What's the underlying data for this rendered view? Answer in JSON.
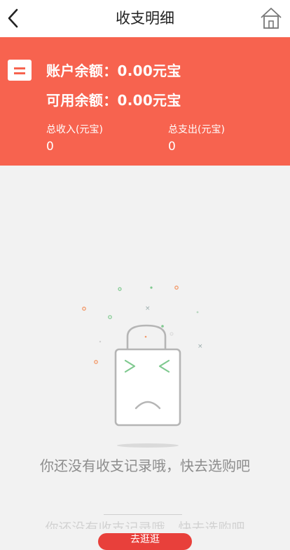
{
  "header": {
    "title": "收支明细",
    "back_icon": "chevron-left-icon",
    "home_icon": "home-icon"
  },
  "summary": {
    "account_balance": "账户余额：0.00元宝",
    "available_balance": "可用余额：0.00元宝",
    "total_income_label": "总收入(元宝)",
    "total_income_value": "0",
    "total_expense_label": "总支出(元宝)",
    "total_expense_value": "0",
    "wallet_icon": "wallet-icon"
  },
  "empty_state": {
    "message": "你还没有收支记录哦，快去选购吧",
    "illustration": "sad-shopping-bag-icon",
    "ghost_message": "你还没有收支记录哦，快去选购吧",
    "cta_label": "去逛逛"
  },
  "colors": {
    "banner": "#f7634f",
    "cta": "#e8403b",
    "empty_text": "#8d8d8d"
  }
}
